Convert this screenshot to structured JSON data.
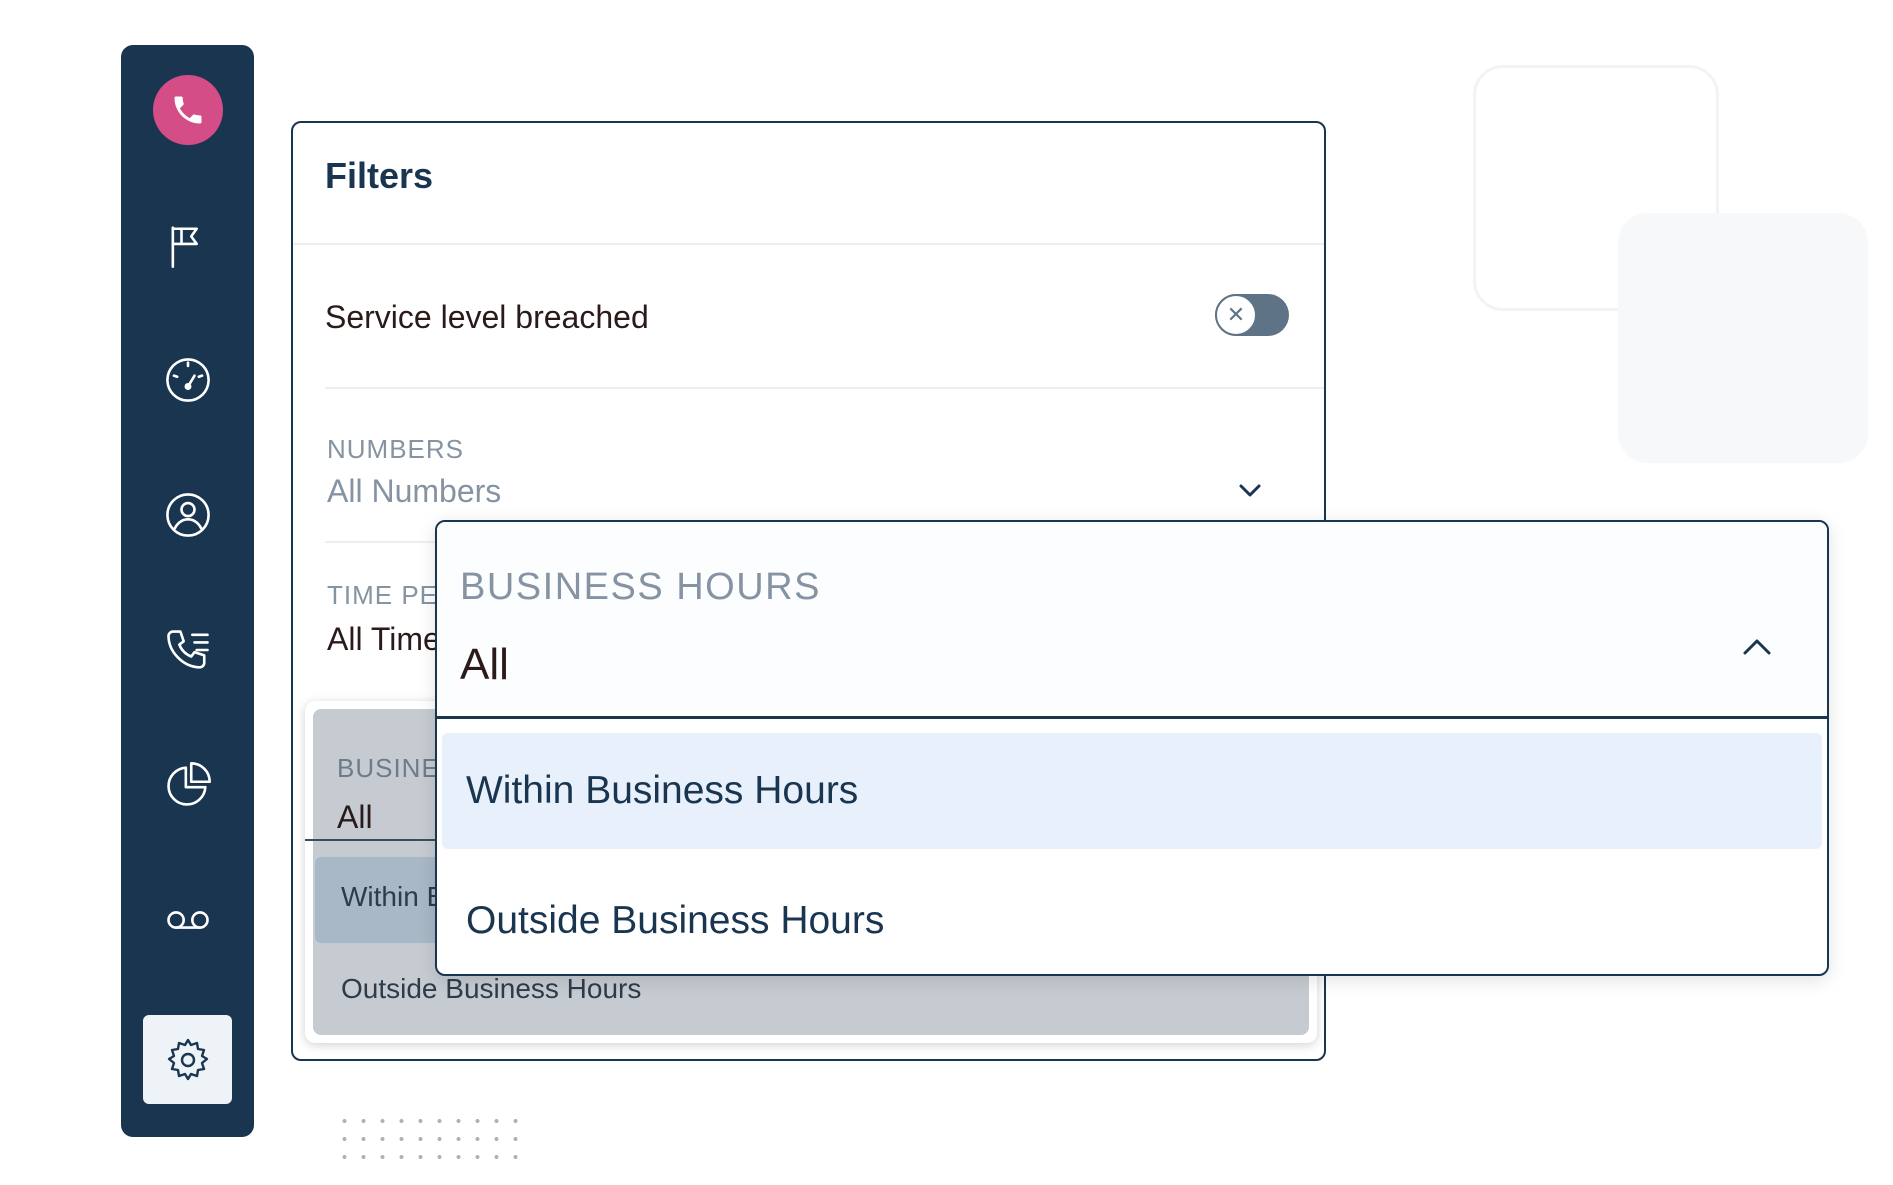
{
  "sidebar": {
    "items": [
      {
        "name": "phone",
        "icon": "phone-icon"
      },
      {
        "name": "flag",
        "icon": "flag-icon"
      },
      {
        "name": "dashboard",
        "icon": "speedometer-icon"
      },
      {
        "name": "contacts",
        "icon": "user-circle-icon"
      },
      {
        "name": "call-list",
        "icon": "phone-list-icon"
      },
      {
        "name": "analytics",
        "icon": "pie-chart-icon"
      },
      {
        "name": "voicemail",
        "icon": "voicemail-icon"
      },
      {
        "name": "settings",
        "icon": "gear-icon",
        "active": true
      }
    ]
  },
  "filters": {
    "title": "Filters",
    "service_level": {
      "label": "Service level breached",
      "enabled": false
    },
    "numbers": {
      "label": "NUMBERS",
      "value": "All Numbers"
    },
    "time_period": {
      "label": "TIME PE",
      "value": "All Time"
    },
    "business_hours_bg": {
      "label": "BUSINES",
      "value": "All",
      "options": [
        "Within B",
        "Outside Business Hours"
      ]
    }
  },
  "business_hours_dropdown": {
    "label": "BUSINESS HOURS",
    "value": "All",
    "options": [
      {
        "label": "Within Business Hours",
        "highlighted": true
      },
      {
        "label": "Outside Business Hours",
        "highlighted": false
      }
    ]
  },
  "colors": {
    "sidebar": "#193550",
    "accent_pink": "#d44d86",
    "highlight": "#e8f1fb"
  }
}
